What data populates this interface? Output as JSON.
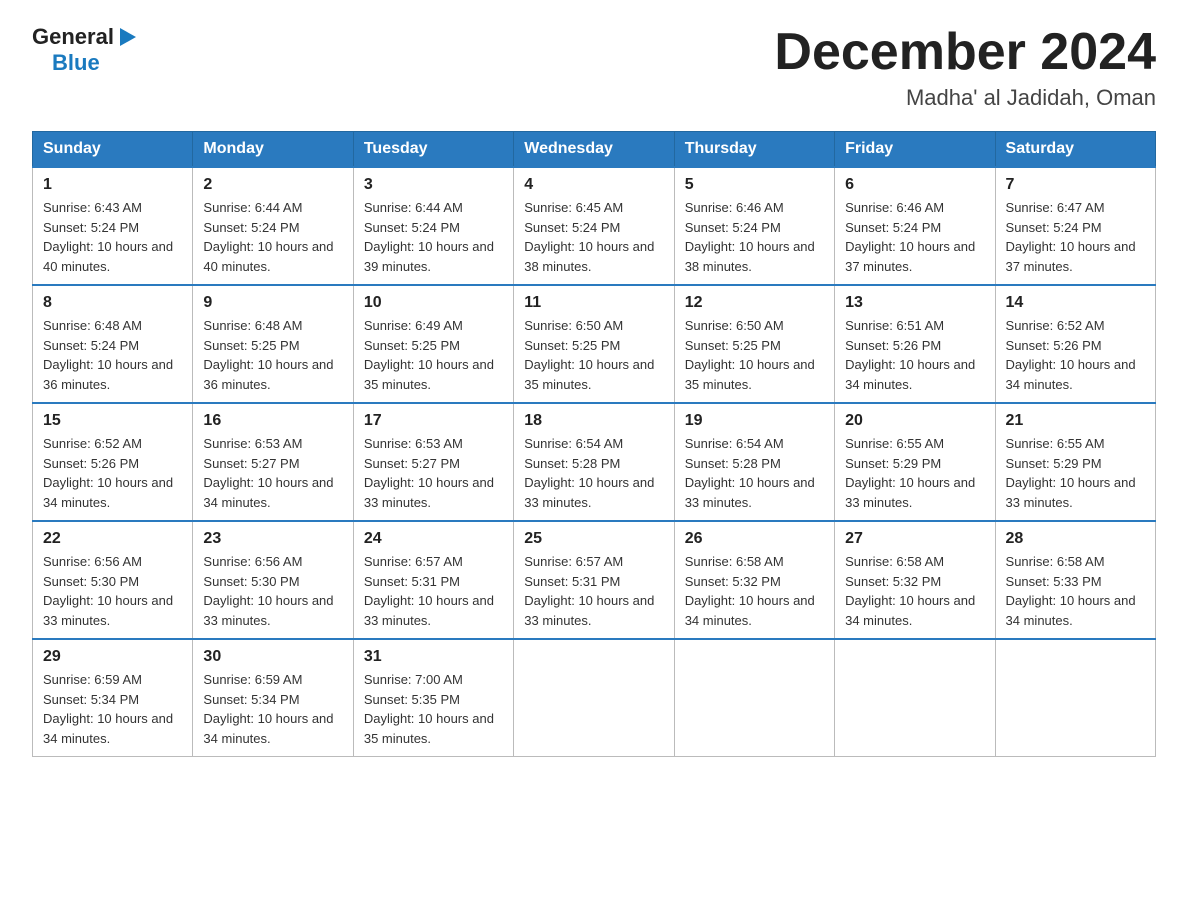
{
  "header": {
    "logo": {
      "general": "General",
      "blue": "Blue"
    },
    "title": "December 2024",
    "location": "Madha' al Jadidah, Oman"
  },
  "days": [
    "Sunday",
    "Monday",
    "Tuesday",
    "Wednesday",
    "Thursday",
    "Friday",
    "Saturday"
  ],
  "weeks": [
    [
      {
        "date": "1",
        "sunrise": "6:43 AM",
        "sunset": "5:24 PM",
        "daylight": "10 hours and 40 minutes."
      },
      {
        "date": "2",
        "sunrise": "6:44 AM",
        "sunset": "5:24 PM",
        "daylight": "10 hours and 40 minutes."
      },
      {
        "date": "3",
        "sunrise": "6:44 AM",
        "sunset": "5:24 PM",
        "daylight": "10 hours and 39 minutes."
      },
      {
        "date": "4",
        "sunrise": "6:45 AM",
        "sunset": "5:24 PM",
        "daylight": "10 hours and 38 minutes."
      },
      {
        "date": "5",
        "sunrise": "6:46 AM",
        "sunset": "5:24 PM",
        "daylight": "10 hours and 38 minutes."
      },
      {
        "date": "6",
        "sunrise": "6:46 AM",
        "sunset": "5:24 PM",
        "daylight": "10 hours and 37 minutes."
      },
      {
        "date": "7",
        "sunrise": "6:47 AM",
        "sunset": "5:24 PM",
        "daylight": "10 hours and 37 minutes."
      }
    ],
    [
      {
        "date": "8",
        "sunrise": "6:48 AM",
        "sunset": "5:24 PM",
        "daylight": "10 hours and 36 minutes."
      },
      {
        "date": "9",
        "sunrise": "6:48 AM",
        "sunset": "5:25 PM",
        "daylight": "10 hours and 36 minutes."
      },
      {
        "date": "10",
        "sunrise": "6:49 AM",
        "sunset": "5:25 PM",
        "daylight": "10 hours and 35 minutes."
      },
      {
        "date": "11",
        "sunrise": "6:50 AM",
        "sunset": "5:25 PM",
        "daylight": "10 hours and 35 minutes."
      },
      {
        "date": "12",
        "sunrise": "6:50 AM",
        "sunset": "5:25 PM",
        "daylight": "10 hours and 35 minutes."
      },
      {
        "date": "13",
        "sunrise": "6:51 AM",
        "sunset": "5:26 PM",
        "daylight": "10 hours and 34 minutes."
      },
      {
        "date": "14",
        "sunrise": "6:52 AM",
        "sunset": "5:26 PM",
        "daylight": "10 hours and 34 minutes."
      }
    ],
    [
      {
        "date": "15",
        "sunrise": "6:52 AM",
        "sunset": "5:26 PM",
        "daylight": "10 hours and 34 minutes."
      },
      {
        "date": "16",
        "sunrise": "6:53 AM",
        "sunset": "5:27 PM",
        "daylight": "10 hours and 34 minutes."
      },
      {
        "date": "17",
        "sunrise": "6:53 AM",
        "sunset": "5:27 PM",
        "daylight": "10 hours and 33 minutes."
      },
      {
        "date": "18",
        "sunrise": "6:54 AM",
        "sunset": "5:28 PM",
        "daylight": "10 hours and 33 minutes."
      },
      {
        "date": "19",
        "sunrise": "6:54 AM",
        "sunset": "5:28 PM",
        "daylight": "10 hours and 33 minutes."
      },
      {
        "date": "20",
        "sunrise": "6:55 AM",
        "sunset": "5:29 PM",
        "daylight": "10 hours and 33 minutes."
      },
      {
        "date": "21",
        "sunrise": "6:55 AM",
        "sunset": "5:29 PM",
        "daylight": "10 hours and 33 minutes."
      }
    ],
    [
      {
        "date": "22",
        "sunrise": "6:56 AM",
        "sunset": "5:30 PM",
        "daylight": "10 hours and 33 minutes."
      },
      {
        "date": "23",
        "sunrise": "6:56 AM",
        "sunset": "5:30 PM",
        "daylight": "10 hours and 33 minutes."
      },
      {
        "date": "24",
        "sunrise": "6:57 AM",
        "sunset": "5:31 PM",
        "daylight": "10 hours and 33 minutes."
      },
      {
        "date": "25",
        "sunrise": "6:57 AM",
        "sunset": "5:31 PM",
        "daylight": "10 hours and 33 minutes."
      },
      {
        "date": "26",
        "sunrise": "6:58 AM",
        "sunset": "5:32 PM",
        "daylight": "10 hours and 34 minutes."
      },
      {
        "date": "27",
        "sunrise": "6:58 AM",
        "sunset": "5:32 PM",
        "daylight": "10 hours and 34 minutes."
      },
      {
        "date": "28",
        "sunrise": "6:58 AM",
        "sunset": "5:33 PM",
        "daylight": "10 hours and 34 minutes."
      }
    ],
    [
      {
        "date": "29",
        "sunrise": "6:59 AM",
        "sunset": "5:34 PM",
        "daylight": "10 hours and 34 minutes."
      },
      {
        "date": "30",
        "sunrise": "6:59 AM",
        "sunset": "5:34 PM",
        "daylight": "10 hours and 34 minutes."
      },
      {
        "date": "31",
        "sunrise": "7:00 AM",
        "sunset": "5:35 PM",
        "daylight": "10 hours and 35 minutes."
      },
      null,
      null,
      null,
      null
    ]
  ]
}
